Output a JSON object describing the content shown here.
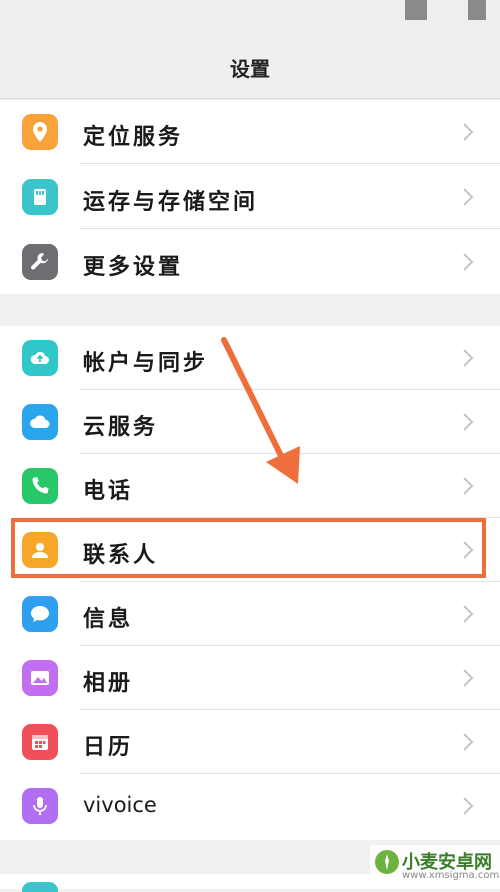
{
  "header": {
    "title": "设置"
  },
  "groups": [
    {
      "items": [
        {
          "label": "定位服务",
          "icon": "location-icon",
          "color": "#f7a23a"
        },
        {
          "label": "运存与存储空间",
          "icon": "storage-icon",
          "color": "#39c5c9"
        },
        {
          "label": "更多设置",
          "icon": "wrench-icon",
          "color": "#6d6d72"
        }
      ]
    },
    {
      "items": [
        {
          "label": "帐户与同步",
          "icon": "cloud-sync-icon",
          "color": "#30c7c8"
        },
        {
          "label": "云服务",
          "icon": "cloud-icon",
          "color": "#2aa6ee"
        },
        {
          "label": "电话",
          "icon": "phone-icon",
          "color": "#27c76a"
        },
        {
          "label": "联系人",
          "icon": "contact-icon",
          "color": "#f6a72a"
        },
        {
          "label": "信息",
          "icon": "message-icon",
          "color": "#2f9ff0"
        },
        {
          "label": "相册",
          "icon": "gallery-icon",
          "color": "#c16ff0"
        },
        {
          "label": "日历",
          "icon": "calendar-icon",
          "color": "#f04f5a"
        },
        {
          "label": "vivoice",
          "icon": "microphone-icon",
          "color": "#b06ff0"
        }
      ]
    }
  ],
  "watermark": {
    "main": "小麦安卓网",
    "sub": "www.xmsigma.com"
  },
  "colors": {
    "highlight": "#ef6f3c",
    "arrow": "#ef6f3c"
  }
}
